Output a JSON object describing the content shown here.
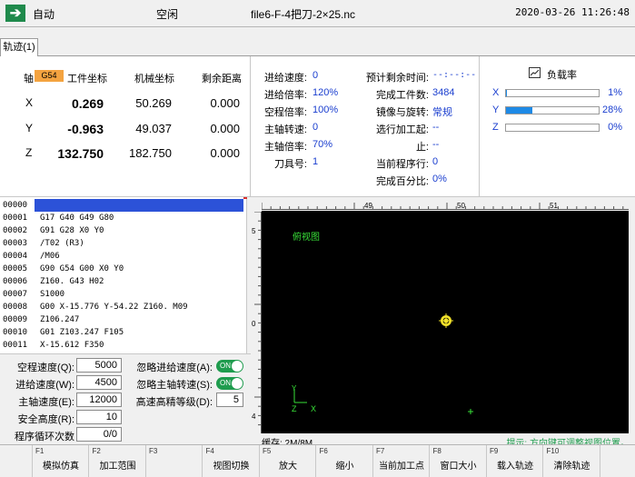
{
  "titlebar": {
    "mode": "自动",
    "state": "空闲",
    "file": "file6-F-4把刀-2×25.nc",
    "datetime": "2020-03-26 11:26:48"
  },
  "tab": {
    "label": "轨迹(1)"
  },
  "coords": {
    "header_axis": "轴",
    "header_cs": "G54",
    "header_work": "工件坐标",
    "header_machine": "机械坐标",
    "header_remaining": "剩余距离",
    "rows": [
      {
        "axis": "X",
        "work": "0.269",
        "machine": "50.269",
        "remaining": "0.000"
      },
      {
        "axis": "Y",
        "work": "-0.963",
        "machine": "49.037",
        "remaining": "0.000"
      },
      {
        "axis": "Z",
        "work": "132.750",
        "machine": "182.750",
        "remaining": "0.000"
      }
    ]
  },
  "status": {
    "left": [
      {
        "label": "进给速度:",
        "value": "0"
      },
      {
        "label": "进给倍率:",
        "value": "120%"
      },
      {
        "label": "空程倍率:",
        "value": "100%"
      },
      {
        "label": "主轴转速:",
        "value": "0"
      },
      {
        "label": "主轴倍率:",
        "value": "70%"
      },
      {
        "label": "刀具号:",
        "value": "1"
      }
    ],
    "right": [
      {
        "label": "预计剩余时间:",
        "value": "--:--:--"
      },
      {
        "label": "完成工件数:",
        "value": "3484"
      },
      {
        "label": "镜像与旋转:",
        "value": "常规"
      },
      {
        "label": "选行加工起:",
        "value": "--"
      },
      {
        "label": "止:",
        "value": "--"
      },
      {
        "label": "当前程序行:",
        "value": "0"
      },
      {
        "label": "完成百分比:",
        "value": "0%"
      }
    ]
  },
  "load": {
    "title": "负载率",
    "icon": "load-chart-icon",
    "rows": [
      {
        "axis": "X",
        "percent": 1,
        "label": "1%"
      },
      {
        "axis": "Y",
        "percent": 28,
        "label": "28%"
      },
      {
        "axis": "Z",
        "percent": 0,
        "label": "0%"
      }
    ]
  },
  "program": {
    "lines": [
      {
        "num": "00000",
        "code": ""
      },
      {
        "num": "00001",
        "code": "G17 G40 G49 G80"
      },
      {
        "num": "00002",
        "code": "G91 G28 X0 Y0"
      },
      {
        "num": "00003",
        "code": "/T02 (R3)"
      },
      {
        "num": "00004",
        "code": "/M06"
      },
      {
        "num": "00005",
        "code": "G90 G54 G00 X0 Y0"
      },
      {
        "num": "00006",
        "code": "Z160. G43 H02"
      },
      {
        "num": "00007",
        "code": " S1000"
      },
      {
        "num": "00008",
        "code": "G00 X-15.776 Y-54.22 Z160. M09"
      },
      {
        "num": "00009",
        "code": "Z106.247"
      },
      {
        "num": "00010",
        "code": "G01 Z103.247 F105"
      },
      {
        "num": "00011",
        "code": "X-15.612 F350"
      }
    ]
  },
  "params": {
    "rapid_speed": {
      "label": "空程速度(Q):",
      "value": "5000"
    },
    "feed_speed": {
      "label": "进给速度(W):",
      "value": "4500"
    },
    "spindle_speed": {
      "label": "主轴速度(E):",
      "value": "12000"
    },
    "safe_height": {
      "label": "安全高度(R):",
      "value": "10"
    },
    "loop_count": {
      "label": "程序循环次数(T):",
      "value": "0/0"
    },
    "ignore_feed": {
      "label": "忽略进给速度(A):",
      "toggle": "ON"
    },
    "ignore_spindle": {
      "label": "忽略主轴转速(S):",
      "toggle": "ON"
    },
    "hs_level": {
      "label": "高速高精等级(D):",
      "value": "5"
    }
  },
  "graphic": {
    "view_label": "俯视图",
    "ruler_top": [
      "49",
      "50",
      "51"
    ],
    "ruler_left": [
      "5",
      "0",
      "4"
    ],
    "cache": "缓存: 2M/8M",
    "hint": "提示: 方向键可调整视图位置。",
    "axis_z": "Z",
    "axis_x": "X"
  },
  "fkeys": [
    {
      "num": "F1",
      "label": "模拟仿真"
    },
    {
      "num": "F2",
      "label": "加工范围"
    },
    {
      "num": "F3",
      "label": ""
    },
    {
      "num": "F4",
      "label": "视图切换"
    },
    {
      "num": "F5",
      "label": "放大"
    },
    {
      "num": "F6",
      "label": "缩小"
    },
    {
      "num": "F7",
      "label": "当前加工点"
    },
    {
      "num": "F8",
      "label": "窗口大小"
    },
    {
      "num": "F9",
      "label": "载入轨迹"
    },
    {
      "num": "F10",
      "label": "清除轨迹"
    }
  ]
}
